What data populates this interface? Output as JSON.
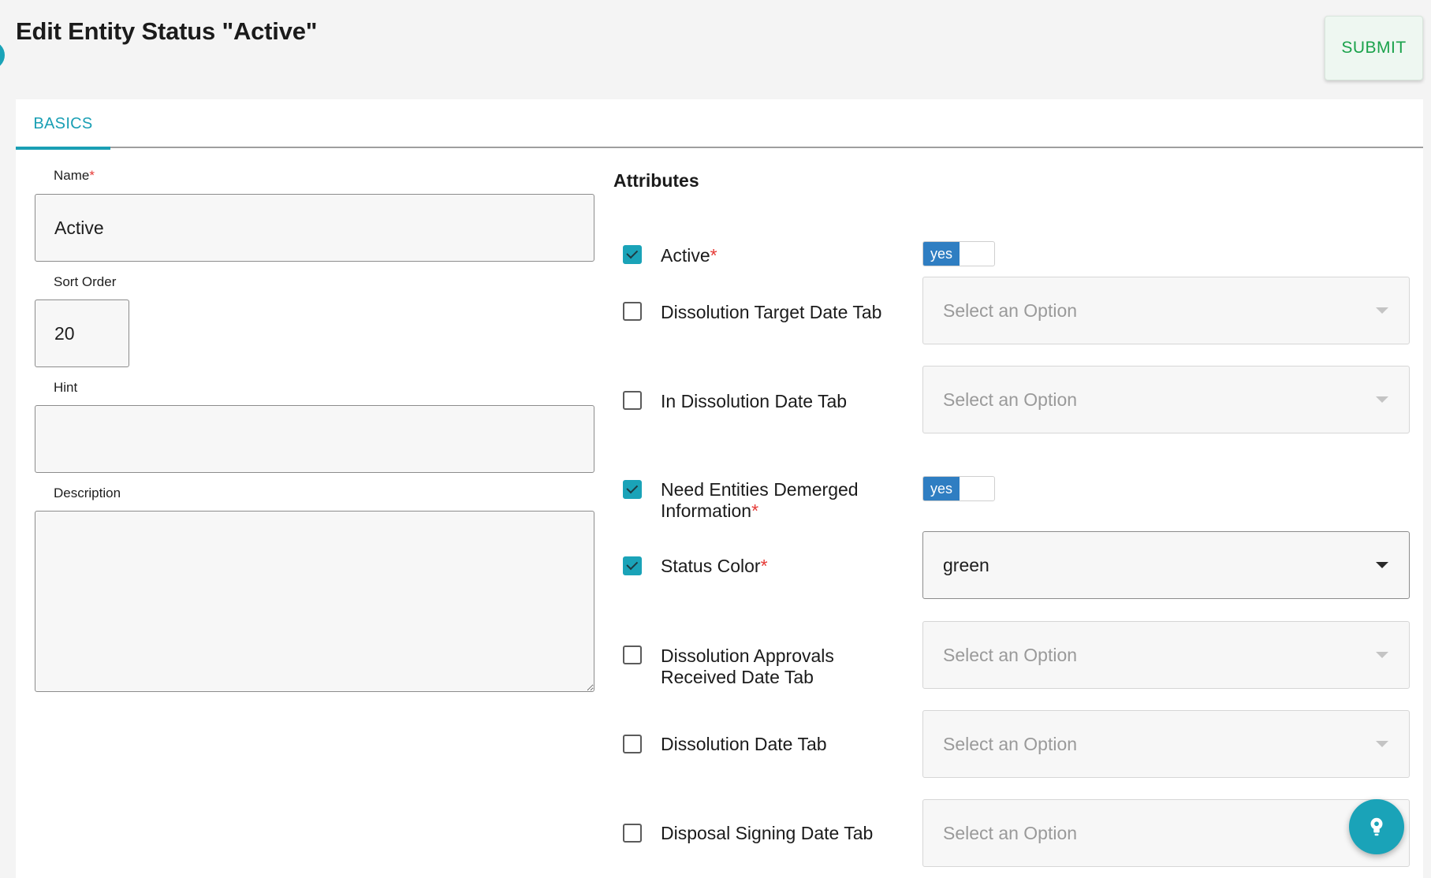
{
  "header": {
    "title": "Edit Entity Status \"Active\"",
    "submit_label": "SUBMIT"
  },
  "tabs": [
    {
      "label": "BASICS",
      "active": true
    }
  ],
  "form": {
    "name": {
      "label": "Name",
      "required_mark": "*",
      "value": "Active"
    },
    "sort_order": {
      "label": "Sort Order",
      "value": "20"
    },
    "hint": {
      "label": "Hint",
      "value": ""
    },
    "description": {
      "label": "Description",
      "value": ""
    }
  },
  "attributes": {
    "title": "Attributes",
    "items": [
      {
        "label": "Active",
        "required_mark": "*",
        "checked": true,
        "control": "toggle",
        "toggle_label": "yes"
      },
      {
        "label": "Dissolution Target Date Tab",
        "required_mark": "",
        "checked": false,
        "control": "select",
        "placeholder": "Select an Option"
      },
      {
        "label": "In Dissolution Date Tab",
        "required_mark": "",
        "checked": false,
        "control": "select",
        "placeholder": "Select an Option"
      },
      {
        "label": "Need Entities Demerged Information",
        "required_mark": "*",
        "checked": true,
        "control": "toggle",
        "toggle_label": "yes"
      },
      {
        "label": "Status Color",
        "required_mark": "*",
        "checked": true,
        "control": "select",
        "value": "green"
      },
      {
        "label": "Dissolution Approvals Received Date Tab",
        "required_mark": "",
        "checked": false,
        "control": "select",
        "placeholder": "Select an Option"
      },
      {
        "label": "Dissolution Date Tab",
        "required_mark": "",
        "checked": false,
        "control": "select",
        "placeholder": "Select an Option"
      },
      {
        "label": "Disposal Signing Date Tab",
        "required_mark": "",
        "checked": false,
        "control": "select",
        "placeholder": "Select an Option"
      }
    ]
  },
  "colors": {
    "accent": "#1aa3b8",
    "toggle_on": "#2f7ec2",
    "submit_text": "#1aa24b",
    "required": "#e53935"
  },
  "icons": {
    "fab": "lightbulb-icon"
  }
}
